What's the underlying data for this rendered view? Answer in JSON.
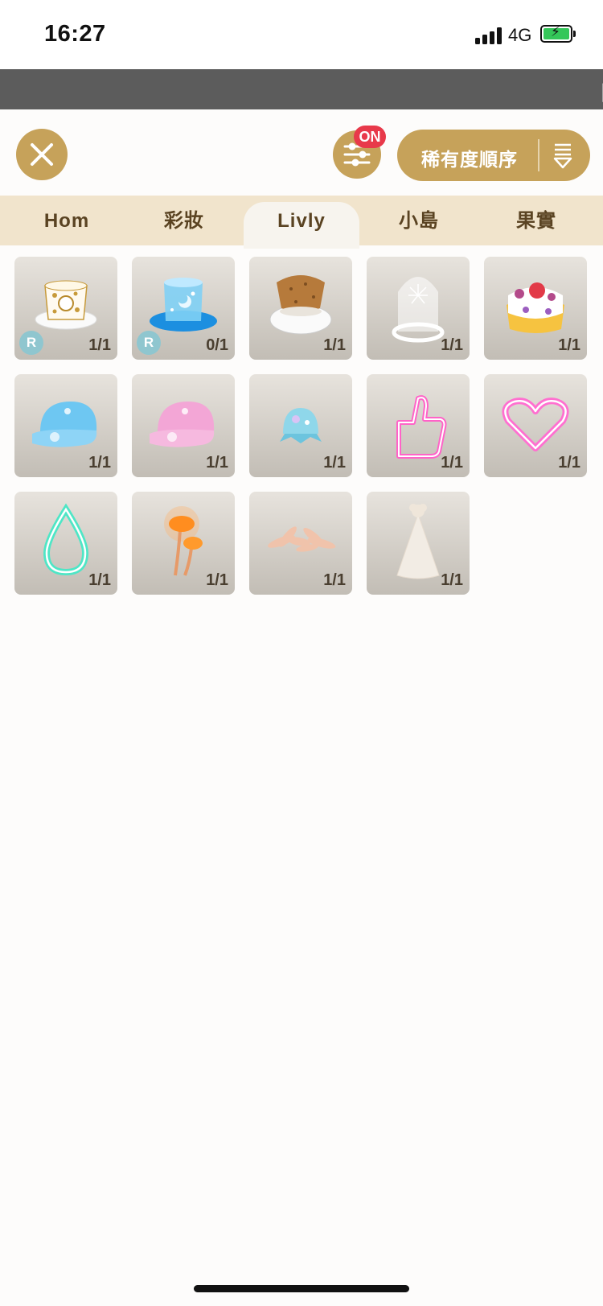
{
  "status_bar": {
    "time": "16:27",
    "network": "4G"
  },
  "banner": {
    "text": "【"
  },
  "toolbar": {
    "filter_badge": "ON",
    "sort_label": "稀有度順序"
  },
  "tabs": [
    {
      "label": "Hom",
      "active": false
    },
    {
      "label": "彩妝",
      "active": false
    },
    {
      "label": "Livly",
      "active": true
    },
    {
      "label": "小島",
      "active": false
    },
    {
      "label": "果實",
      "active": false
    }
  ],
  "items": [
    {
      "icon": "paper-cup-hat-icon",
      "count": "1/1",
      "rarity": "R"
    },
    {
      "icon": "aquarium-top-hat-icon",
      "count": "0/1",
      "rarity": "R"
    },
    {
      "icon": "cork-hat-icon",
      "count": "1/1"
    },
    {
      "icon": "glass-dome-icon",
      "count": "1/1"
    },
    {
      "icon": "strawberry-cake-icon",
      "count": "1/1"
    },
    {
      "icon": "blue-cap-icon",
      "count": "1/1"
    },
    {
      "icon": "pink-cap-icon",
      "count": "1/1"
    },
    {
      "icon": "jelly-orb-icon",
      "count": "1/1"
    },
    {
      "icon": "neon-thumbs-up-icon",
      "count": "1/1"
    },
    {
      "icon": "neon-heart-icon",
      "count": "1/1"
    },
    {
      "icon": "neon-drop-icon",
      "count": "1/1"
    },
    {
      "icon": "glowing-mushroom-icon",
      "count": "1/1"
    },
    {
      "icon": "feather-tuft-icon",
      "count": "1/1"
    },
    {
      "icon": "party-hat-icon",
      "count": "1/1"
    }
  ]
}
